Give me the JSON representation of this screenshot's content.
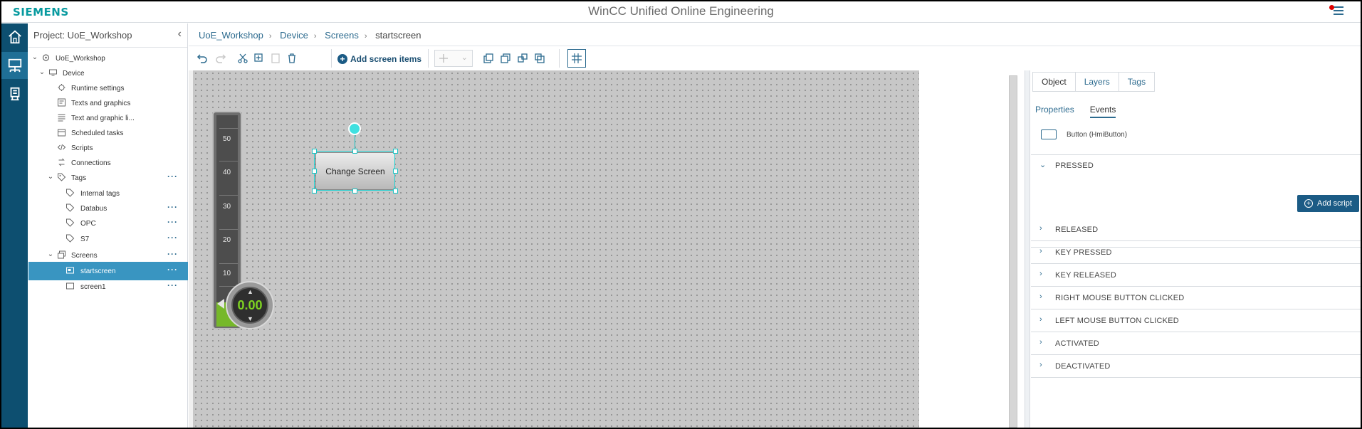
{
  "app": {
    "logo": "SIEMENS",
    "title": "WinCC Unified Online Engineering"
  },
  "tree": {
    "header": "Project: UoE_Workshop",
    "nodes": [
      {
        "label": "UoE_Workshop"
      },
      {
        "label": "Device"
      },
      {
        "label": "Runtime settings"
      },
      {
        "label": "Texts and graphics"
      },
      {
        "label": "Text and graphic li..."
      },
      {
        "label": "Scheduled tasks"
      },
      {
        "label": "Scripts"
      },
      {
        "label": "Connections"
      },
      {
        "label": "Tags"
      },
      {
        "label": "Internal tags"
      },
      {
        "label": "Databus"
      },
      {
        "label": "OPC"
      },
      {
        "label": "S7"
      },
      {
        "label": "Screens"
      },
      {
        "label": "startscreen"
      },
      {
        "label": "screen1"
      }
    ],
    "more": "···"
  },
  "breadcrumb": [
    "UoE_Workshop",
    "Device",
    "Screens",
    "startscreen"
  ],
  "toolbar": {
    "add_screen_items": "Add screen items"
  },
  "canvas": {
    "bar_labels": [
      "50",
      "40",
      "30",
      "20",
      "10"
    ],
    "gauge_value": "0.00",
    "button_text": "Change Screen"
  },
  "panel": {
    "tabs": [
      "Object",
      "Layers",
      "Tags"
    ],
    "subtabs": [
      "Properties",
      "Events"
    ],
    "object": "Button (HmiButton)",
    "add_script": "Add script",
    "events": [
      "PRESSED",
      "RELEASED",
      "KEY PRESSED",
      "KEY RELEASED",
      "RIGHT MOUSE BUTTON CLICKED",
      "LEFT MOUSE BUTTON CLICKED",
      "ACTIVATED",
      "DEACTIVATED"
    ]
  }
}
